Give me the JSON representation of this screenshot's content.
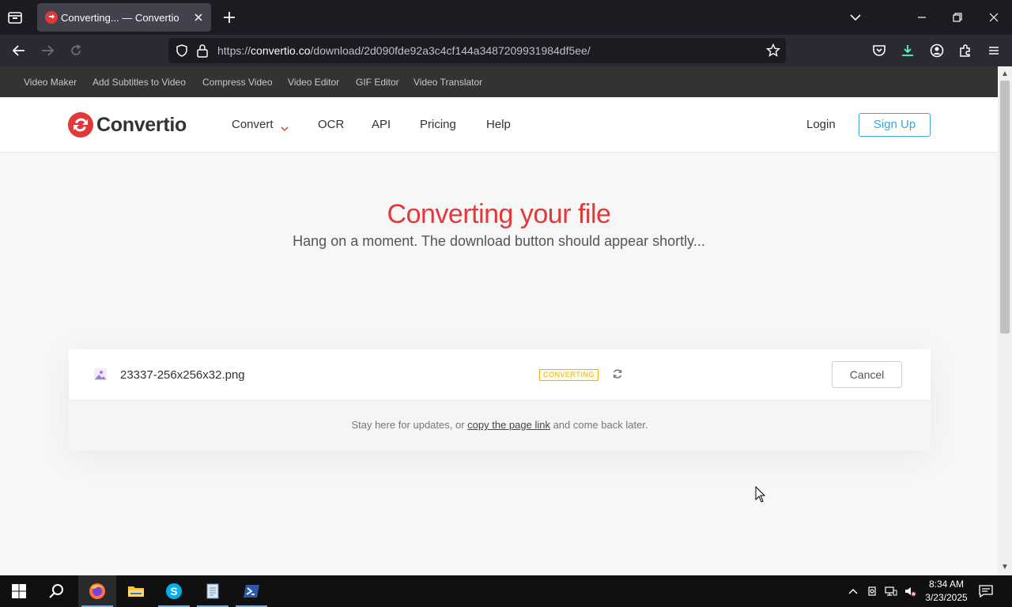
{
  "browser": {
    "tab_title": "Converting... — Convertio",
    "url_prefix": "https://",
    "url_host": "convertio.co",
    "url_path": "/download/2d090fde92a3c4cf144a3487209931984df5ee/"
  },
  "bookmarks": [
    "Video Maker",
    "Add Subtitles to Video",
    "Compress Video",
    "Video Editor",
    "GIF Editor",
    "Video Translator"
  ],
  "header": {
    "logo_text": "Convertio",
    "menu": [
      "Convert",
      "OCR",
      "API",
      "Pricing",
      "Help"
    ],
    "login": "Login",
    "signup": "Sign Up"
  },
  "hero": {
    "title": "Converting your file",
    "subtitle": "Hang on a moment. The download button should appear shortly..."
  },
  "file": {
    "name": "23337-256x256x32.png",
    "status": "CONVERTING",
    "cancel": "Cancel",
    "info_before": "Stay here for updates, or ",
    "info_link": "copy the page link",
    "info_after": " and come back later."
  },
  "taskbar": {
    "time": "8:34 AM",
    "date": "3/23/2025"
  },
  "colors": {
    "brand_red": "#e23838",
    "signup_blue": "#3aa7d8",
    "status_yellow": "#e8b20b"
  }
}
